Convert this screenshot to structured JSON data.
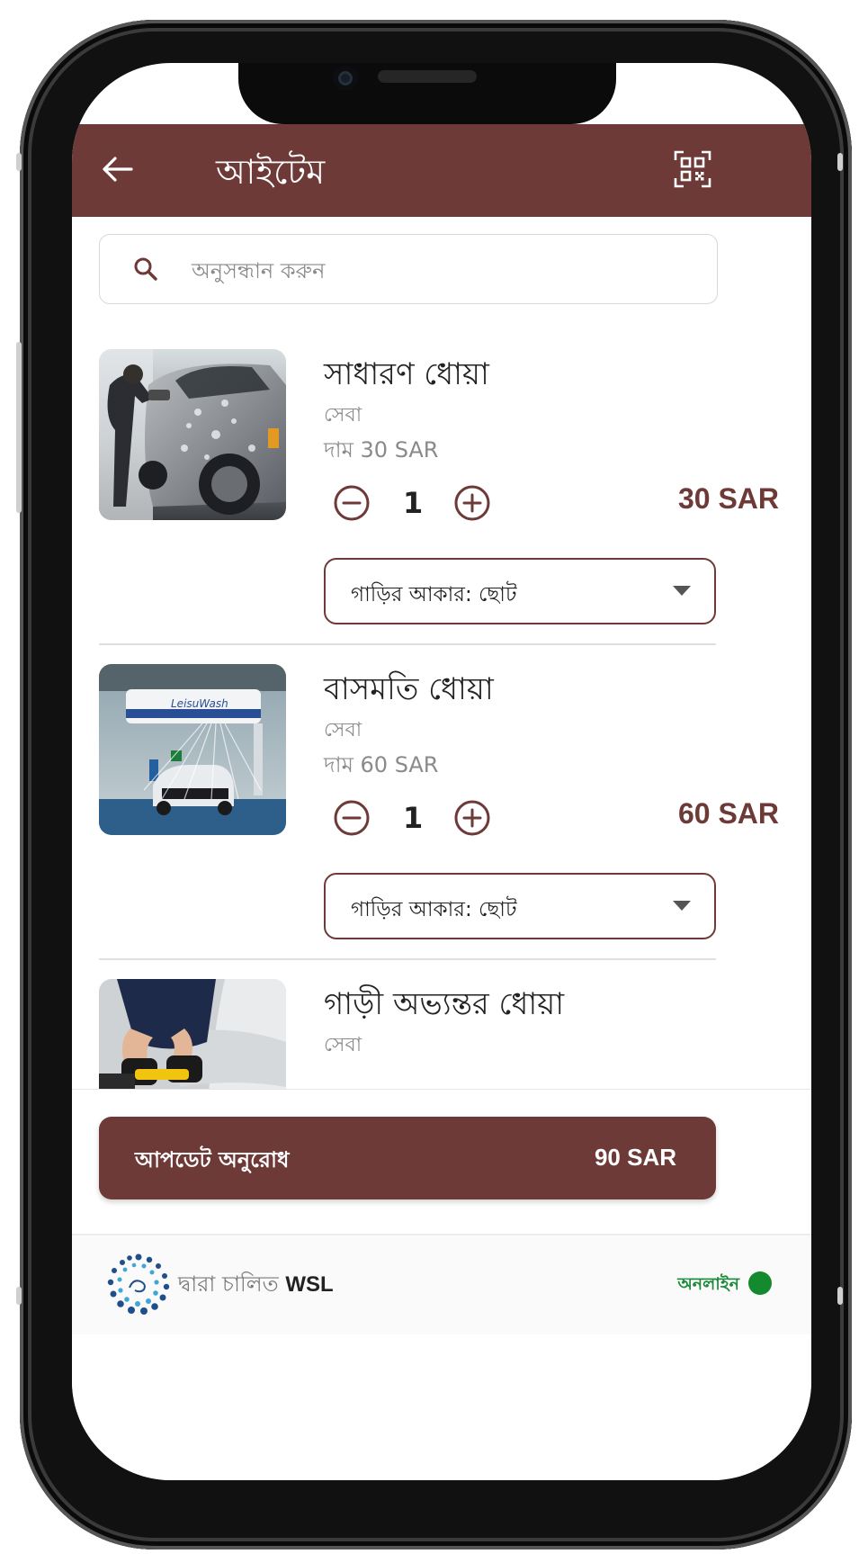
{
  "appbar": {
    "title": "আইটেম",
    "back_icon": "arrow-left-icon",
    "scan_icon": "qr-scan-icon"
  },
  "search": {
    "placeholder": "অনুসন্ধান করুন",
    "icon": "search-icon"
  },
  "items": [
    {
      "name": "সাধারণ ধোয়া",
      "category": "সেবা",
      "price_line": "দাম 30 SAR",
      "quantity": "1",
      "total": "30 SAR",
      "variant_select": "গাড়ির আকার: ছোট",
      "image": "car-hand-wash-photo"
    },
    {
      "name": "বাসমতি ধোয়া",
      "category": "সেবা",
      "price_line": "দাম 60 SAR",
      "quantity": "1",
      "total": "60 SAR",
      "variant_select": "গাড়ির আকার: ছোট",
      "image": "automatic-car-wash-photo"
    },
    {
      "name": "গাড়ী অভ্যন্তর ধোয়া",
      "category": "সেবা",
      "image": "car-interior-cleaning-photo"
    }
  ],
  "update_button": {
    "label": "আপডেট অনুরোধ",
    "total": "90 SAR"
  },
  "footer": {
    "powered_by": "দ্বারা চালিত",
    "brand": "WSL",
    "status": "অনলাইন",
    "status_color": "#138a2e"
  },
  "colors": {
    "primary": "#6e3a38"
  }
}
